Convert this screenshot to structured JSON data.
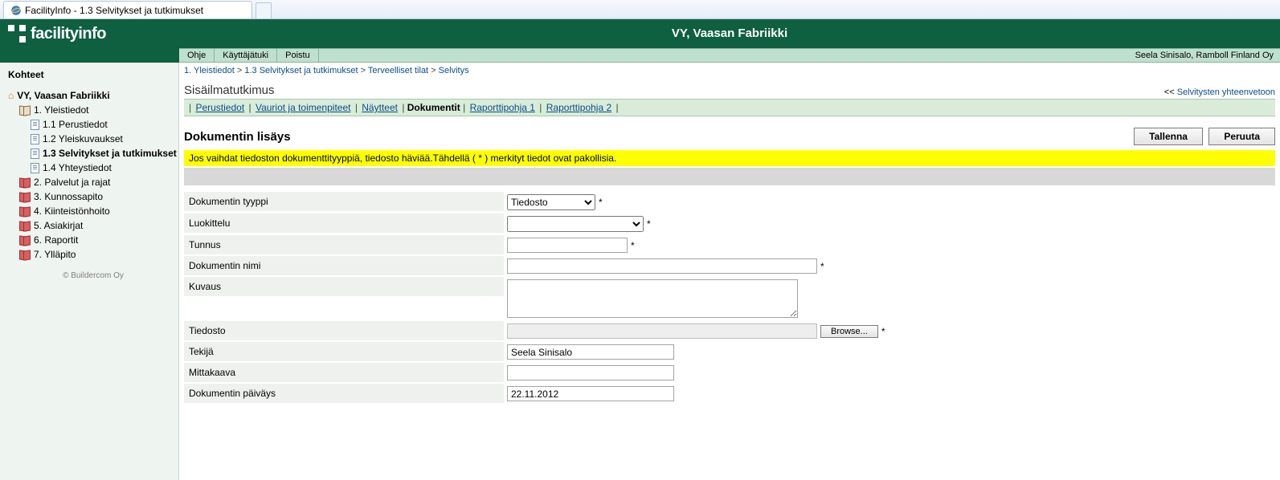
{
  "browser_tab": {
    "title": "FacilityInfo - 1.3 Selvitykset ja tutkimukset"
  },
  "header": {
    "logo_text": "facilityinfo",
    "center_title": "VY, Vaasan Fabriikki",
    "menu": {
      "ohje": "Ohje",
      "kayttajatuki": "Käyttäjätuki",
      "poistu": "Poistu"
    },
    "user": "Seela Sinisalo, Ramboll Finland Oy"
  },
  "sidebar": {
    "heading": "Kohteet",
    "root": "VY, Vaasan Fabriikki",
    "items": [
      {
        "label": "1. Yleistiedot",
        "icon": "book",
        "lvl": 2
      },
      {
        "label": "1.1 Perustiedot",
        "icon": "page",
        "lvl": 3
      },
      {
        "label": "1.2 Yleiskuvaukset",
        "icon": "page",
        "lvl": 3
      },
      {
        "label": "1.3 Selvitykset ja tutkimukset",
        "icon": "page",
        "lvl": 3,
        "selected": true
      },
      {
        "label": "1.4 Yhteystiedot",
        "icon": "page",
        "lvl": 3
      },
      {
        "label": "2. Palvelut ja rajat",
        "icon": "book-red",
        "lvl": 2
      },
      {
        "label": "3. Kunnossapito",
        "icon": "book-red",
        "lvl": 2
      },
      {
        "label": "4. Kiinteistönhoito",
        "icon": "book-red",
        "lvl": 2
      },
      {
        "label": "5. Asiakirjat",
        "icon": "book-red",
        "lvl": 2
      },
      {
        "label": "6. Raportit",
        "icon": "book-red",
        "lvl": 2
      },
      {
        "label": "7. Ylläpito",
        "icon": "book-red",
        "lvl": 2
      }
    ],
    "footer": "© Buildercom Oy"
  },
  "breadcrumb": {
    "a": "1. Yleistiedot",
    "b": "1.3 Selvitykset ja tutkimukset",
    "c": "Terveelliset tilat",
    "d": "Selvitys"
  },
  "page": {
    "title": "Sisäilmatutkimus",
    "back_prefix": "<<",
    "back": "Selvitysten yhteenvetoon"
  },
  "subtabs": {
    "perustiedot": "Perustiedot",
    "vauriot": "Vauriot ja toimenpiteet",
    "naytteet": "Näytteet",
    "dokumentit": "Dokumentit",
    "raportti1": "Raporttipohja 1",
    "raportti2": "Raporttipohja 2"
  },
  "section": {
    "title": "Dokumentin lisäys",
    "save": "Tallenna",
    "cancel": "Peruuta"
  },
  "warning": "Jos vaihdat tiedoston dokumenttityyppiä, tiedosto häviää.Tähdellä ( * ) merkityt tiedot ovat pakollisia.",
  "form": {
    "labels": {
      "tyyppi": "Dokumentin tyyppi",
      "luokittelu": "Luokittelu",
      "tunnus": "Tunnus",
      "nimi": "Dokumentin nimi",
      "kuvaus": "Kuvaus",
      "tiedosto": "Tiedosto",
      "tekija": "Tekijä",
      "mittakaava": "Mittakaava",
      "paivays": "Dokumentin päiväys"
    },
    "values": {
      "tyyppi_selected": "Tiedosto",
      "luokittelu_selected": "",
      "tunnus": "",
      "nimi": "",
      "kuvaus": "",
      "tiedosto": "",
      "browse": "Browse...",
      "tekija": "Seela Sinisalo",
      "mittakaava": "",
      "paivays": "22.11.2012"
    },
    "required_mark": "*"
  }
}
